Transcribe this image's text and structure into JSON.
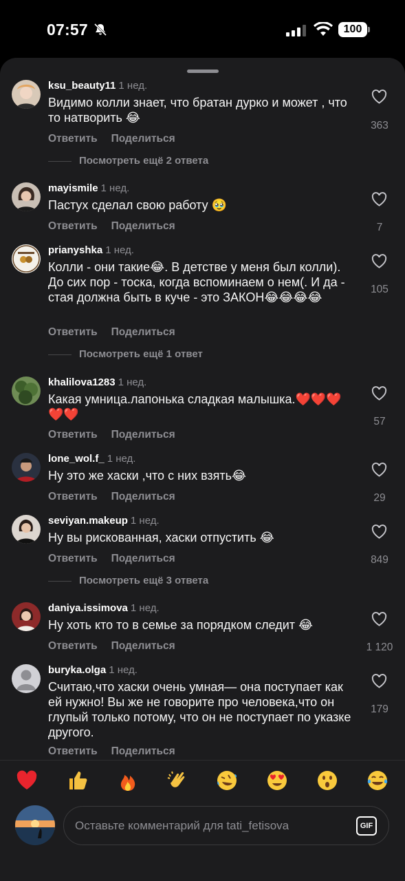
{
  "status_bar": {
    "time": "07:57",
    "battery": "100"
  },
  "comments": [
    {
      "username": "ksu_beauty11",
      "time": "1 нед.",
      "text": "Видимо колли знает, что братан дурко и может , что то натворить 😂",
      "likes": "363",
      "more_replies": "Посмотреть ещё 2 ответа"
    },
    {
      "username": "mayismile",
      "time": "1 нед.",
      "text": "Пастух сделал свою работу 🥹",
      "likes": "7",
      "more_replies": ""
    },
    {
      "username": "prianyshka",
      "time": "1 нед.",
      "text": "Колли - они такие😂. В детстве у меня был колли). До сих пор - тоска, когда вспоминаем о нем(. И да - стая должна быть в куче - это ЗАКОН😂😂😂😂",
      "likes": "105",
      "more_replies": "Посмотреть ещё 1 ответ"
    },
    {
      "username": "khalilova1283",
      "time": "1 нед.",
      "text": "Какая умница.лапонька сладкая малышка.❤️❤️❤️❤️❤️",
      "likes": "57",
      "more_replies": ""
    },
    {
      "username": "lone_wol.f_",
      "time": "1 нед.",
      "text": "Ну это же хаски ,что с них взять😂",
      "likes": "29",
      "more_replies": ""
    },
    {
      "username": "seviyan.makeup",
      "time": "1 нед.",
      "text": "Ну вы рискованная, хаски отпустить 😂",
      "likes": "849",
      "more_replies": "Посмотреть ещё 3 ответа"
    },
    {
      "username": "daniya.issimova",
      "time": "1 нед.",
      "text": "Ну хоть кто то в семье за порядком следит 😂",
      "likes": "1 120",
      "more_replies": ""
    },
    {
      "username": "buryka.olga",
      "time": "1 нед.",
      "text": "Считаю,что хаски очень умная— она поступает как ей нужно! Вы же не говорите про человека,что он глупый только потому, что он не поступает по указке другого.",
      "likes": "179",
      "more_replies": ""
    }
  ],
  "actions": {
    "reply": "Ответить",
    "share": "Поделиться"
  },
  "reactions": [
    "red-heart",
    "thumbs-up",
    "fire",
    "clapping-hands",
    "rolling-laughing",
    "heart-eyes",
    "surprised",
    "tears-of-joy"
  ],
  "composer": {
    "placeholder": "Оставьте комментарий для tati_fetisova",
    "gif_label": "GIF"
  },
  "colors": {
    "background": "#000000",
    "sheet": "#1c1c1e",
    "secondary_text": "#8e8e93",
    "heart_red": "#e8242d"
  }
}
